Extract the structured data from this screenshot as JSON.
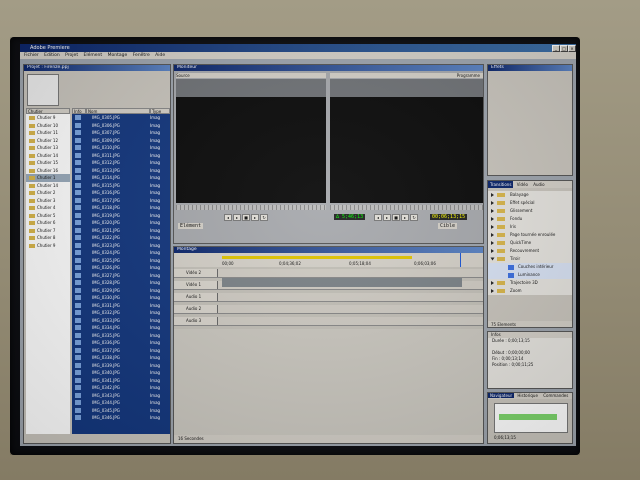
{
  "app": {
    "title": "Adobe Premiere"
  },
  "menu": [
    "Fichier",
    "Edition",
    "Projet",
    "Elément",
    "Montage",
    "Fenêtre",
    "Aide"
  ],
  "project": {
    "title": "Projet : Firenze.ppj",
    "headers": {
      "bins": "Chutier",
      "info": "Info",
      "name": "Nom",
      "type": "Type"
    },
    "bins": [
      "Chutier 9",
      "Chutier 10",
      "Chutier 11",
      "Chutier 12",
      "Chutier 13",
      "Chutier 14",
      "Chutier 15",
      "Chutier 16",
      "Chutier 1",
      "Chutier 14",
      "Chutier 2",
      "Chutier 3",
      "Chutier 4",
      "Chutier 5",
      "Chutier 6",
      "Chutier 7",
      "Chutier 8",
      "Chutier 9"
    ],
    "clips": [
      {
        "name": "IMG_0305.JPG",
        "type": "Imag"
      },
      {
        "name": "IMG_0306.JPG",
        "type": "Imag"
      },
      {
        "name": "IMG_0307.JPG",
        "type": "Imag"
      },
      {
        "name": "IMG_0309.JPG",
        "type": "Imag"
      },
      {
        "name": "IMG_0310.JPG",
        "type": "Imag"
      },
      {
        "name": "IMG_0311.JPG",
        "type": "Imag"
      },
      {
        "name": "IMG_0312.JPG",
        "type": "Imag"
      },
      {
        "name": "IMG_0313.JPG",
        "type": "Imag"
      },
      {
        "name": "IMG_0314.JPG",
        "type": "Imag"
      },
      {
        "name": "IMG_0315.JPG",
        "type": "Imag"
      },
      {
        "name": "IMG_0316.JPG",
        "type": "Imag"
      },
      {
        "name": "IMG_0317.JPG",
        "type": "Imag"
      },
      {
        "name": "IMG_0318.JPG",
        "type": "Imag"
      },
      {
        "name": "IMG_0319.JPG",
        "type": "Imag"
      },
      {
        "name": "IMG_0320.JPG",
        "type": "Imag"
      },
      {
        "name": "IMG_0321.JPG",
        "type": "Imag"
      },
      {
        "name": "IMG_0322.JPG",
        "type": "Imag"
      },
      {
        "name": "IMG_0323.JPG",
        "type": "Imag"
      },
      {
        "name": "IMG_0324.JPG",
        "type": "Imag"
      },
      {
        "name": "IMG_0325.JPG",
        "type": "Imag"
      },
      {
        "name": "IMG_0326.JPG",
        "type": "Imag"
      },
      {
        "name": "IMG_0327.JPG",
        "type": "Imag"
      },
      {
        "name": "IMG_0328.JPG",
        "type": "Imag"
      },
      {
        "name": "IMG_0329.JPG",
        "type": "Imag"
      },
      {
        "name": "IMG_0330.JPG",
        "type": "Imag"
      },
      {
        "name": "IMG_0331.JPG",
        "type": "Imag"
      },
      {
        "name": "IMG_0332.JPG",
        "type": "Imag"
      },
      {
        "name": "IMG_0333.JPG",
        "type": "Imag"
      },
      {
        "name": "IMG_0334.JPG",
        "type": "Imag"
      },
      {
        "name": "IMG_0335.JPG",
        "type": "Imag"
      },
      {
        "name": "IMG_0336.JPG",
        "type": "Imag"
      },
      {
        "name": "IMG_0337.JPG",
        "type": "Imag"
      },
      {
        "name": "IMG_0338.JPG",
        "type": "Imag"
      },
      {
        "name": "IMG_0339.JPG",
        "type": "Imag"
      },
      {
        "name": "IMG_0340.JPG",
        "type": "Imag"
      },
      {
        "name": "IMG_0341.JPG",
        "type": "Imag"
      },
      {
        "name": "IMG_0342.JPG",
        "type": "Imag"
      },
      {
        "name": "IMG_0343.JPG",
        "type": "Imag"
      },
      {
        "name": "IMG_0344.JPG",
        "type": "Imag"
      },
      {
        "name": "IMG_0345.JPG",
        "type": "Imag"
      },
      {
        "name": "IMG_0346.JPG",
        "type": "Imag"
      }
    ]
  },
  "monitor": {
    "title": "Moniteur",
    "source_label": "Source",
    "program_label": "Programme",
    "source_dropdown": "Elément",
    "program_dropdown": "Cible",
    "source_timecode": "∆ 5;46;13",
    "program_timecode": "00;06;13;15"
  },
  "timeline": {
    "title": "Montage",
    "ruler_labels": [
      "00;00",
      "0;04;36;02",
      "0;05;18;04",
      "0;06;03;06"
    ],
    "tracks": [
      {
        "label": "Vidéo 2"
      },
      {
        "label": "Vidéo 1"
      },
      {
        "label": "Audio 1"
      },
      {
        "label": "Audio 2"
      },
      {
        "label": "Audio 3"
      }
    ],
    "zoom_label": "16 Secondes"
  },
  "effects": {
    "title": "Effets"
  },
  "transitions": {
    "tabs": [
      "Transitions",
      "Vidéo",
      "Audio"
    ],
    "items": [
      {
        "label": "Balayage",
        "type": "folder"
      },
      {
        "label": "Effet spécial",
        "type": "folder"
      },
      {
        "label": "Glissement",
        "type": "folder"
      },
      {
        "label": "Fondu",
        "type": "folder"
      },
      {
        "label": "Iris",
        "type": "folder"
      },
      {
        "label": "Page tournée enroulée",
        "type": "folder"
      },
      {
        "label": "QuickTime",
        "type": "folder"
      },
      {
        "label": "Recouvrement",
        "type": "folder"
      },
      {
        "label": "Tiroir",
        "type": "folder-open"
      },
      {
        "label": "Couches intérieur",
        "type": "item"
      },
      {
        "label": "Luminance",
        "type": "item"
      },
      {
        "label": "Trajectoire 3D",
        "type": "folder"
      },
      {
        "label": "Zoom",
        "type": "folder"
      }
    ],
    "count": "75 Elements"
  },
  "info": {
    "title": "Infos",
    "lines": [
      "Durée : 0;00;13;15",
      "",
      "Début : 0;00;00;00",
      "Fin : 0;00;13;14",
      "Position : 0;00;11;25"
    ]
  },
  "navigator": {
    "tabs": [
      "Navigateur",
      "Historique",
      "Commandes"
    ],
    "zoom": "0;06;13;15"
  }
}
